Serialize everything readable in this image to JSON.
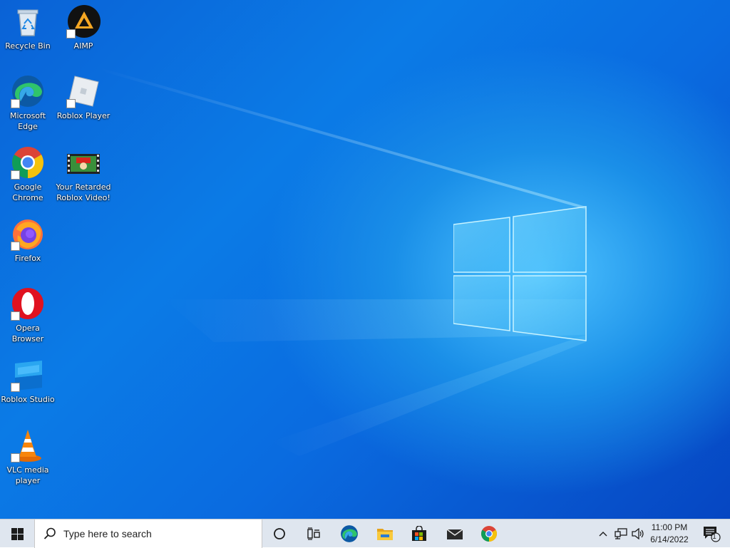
{
  "desktop": {
    "icons": [
      {
        "label": "Recycle Bin",
        "icon": "recycle-bin-icon"
      },
      {
        "label": "AIMP",
        "icon": "aimp-icon"
      },
      {
        "label": "Microsoft Edge",
        "icon": "edge-icon"
      },
      {
        "label": "Roblox Player",
        "icon": "roblox-player-icon"
      },
      {
        "label": "Google Chrome",
        "icon": "chrome-icon"
      },
      {
        "label": "Your Retarded Roblox Video!",
        "icon": "video-file-icon"
      },
      {
        "label": "Firefox",
        "icon": "firefox-icon"
      },
      {
        "label": "Opera Browser",
        "icon": "opera-icon"
      },
      {
        "label": "Roblox Studio",
        "icon": "roblox-studio-icon"
      },
      {
        "label": "VLC media player",
        "icon": "vlc-icon"
      }
    ]
  },
  "taskbar": {
    "search_placeholder": "Type here to search",
    "pinned": [
      "start-icon",
      "cortana-icon",
      "task-view-icon",
      "edge-icon",
      "file-explorer-icon",
      "store-icon",
      "mail-icon",
      "chrome-icon"
    ],
    "clock_time": "11:00 PM",
    "clock_date": "6/14/2022",
    "notification_count": "1"
  },
  "colors": {
    "wallpaper_blue": "#0a6be0",
    "taskbar": "#dfe6ef"
  }
}
